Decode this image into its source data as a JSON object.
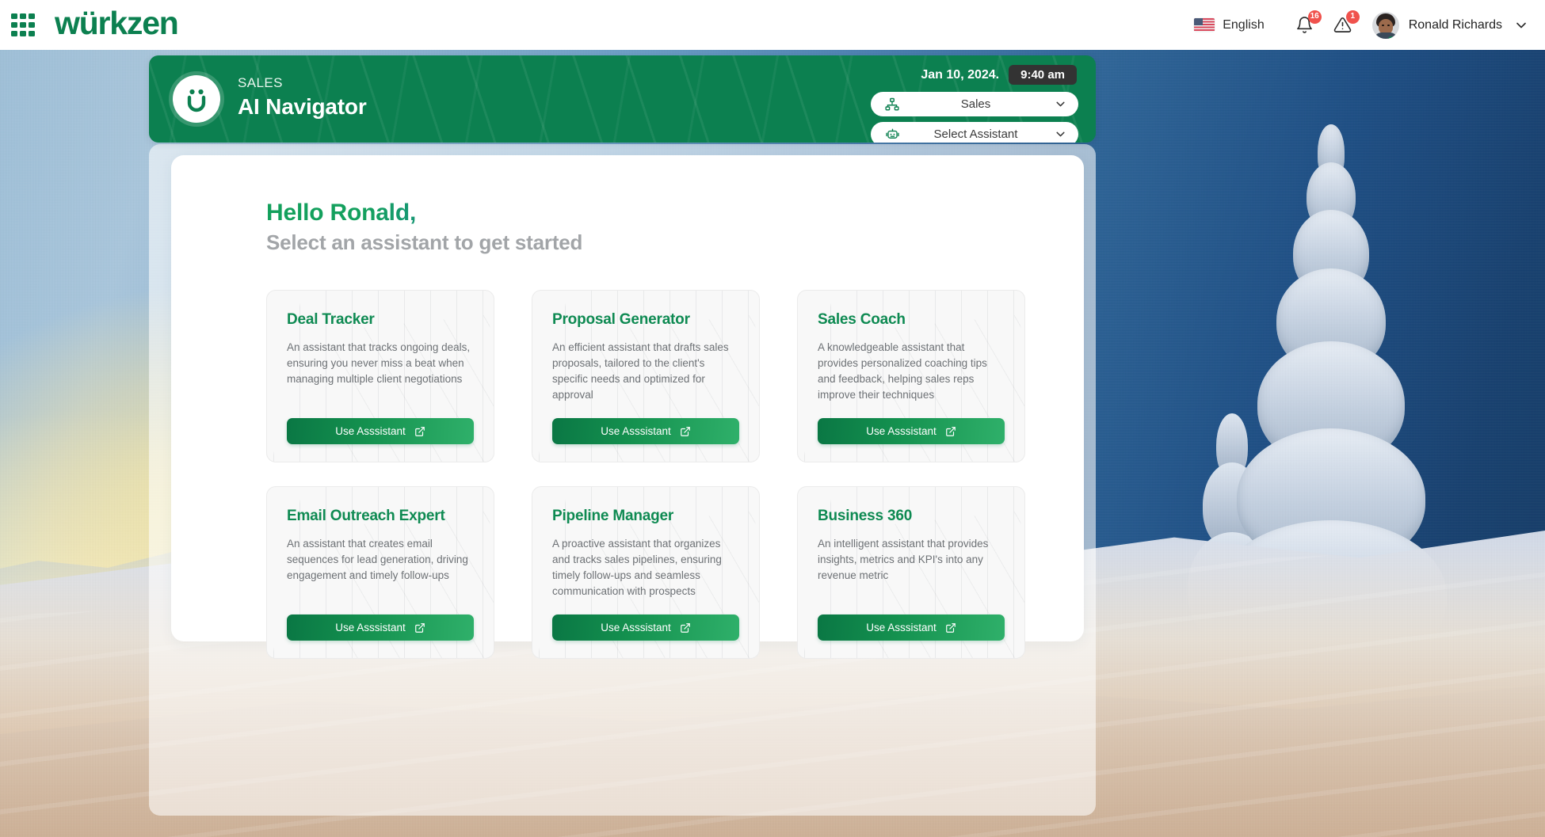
{
  "topbar": {
    "app_grid_icon": "apps-grid-icon",
    "brand": "würkzen",
    "language": {
      "label": "English",
      "flag_icon": "us-flag-icon"
    },
    "notifications": {
      "icon": "bell-icon",
      "badge": "16"
    },
    "alerts": {
      "icon": "warning-triangle-icon",
      "badge": "1"
    },
    "user": {
      "name": "Ronald Richards",
      "avatar_icon": "user-avatar",
      "chevron_icon": "chevron-down-icon"
    }
  },
  "banner": {
    "logo_icon": "wurkzen-smiley-logo",
    "kicker": "SALES",
    "title": "AI Navigator",
    "date": "Jan 10, 2024.",
    "time": "9:40 am",
    "department_select": {
      "icon": "org-chart-icon",
      "value": "Sales",
      "chevron_icon": "chevron-down-icon"
    },
    "assistant_select": {
      "icon": "robot-icon",
      "value": "Select Assistant",
      "chevron_icon": "chevron-down-icon"
    }
  },
  "main": {
    "greeting": "Hello Ronald,",
    "subheading": "Select an assistant to get started",
    "button_label": "Use Asssistant",
    "button_icon": "external-link-icon",
    "cards": [
      {
        "title": "Deal Tracker",
        "description": "An assistant that tracks ongoing deals, ensuring you never miss a beat when managing multiple client negotiations"
      },
      {
        "title": "Proposal Generator",
        "description": "An efficient assistant that drafts sales proposals, tailored to the client's specific needs and optimized for approval"
      },
      {
        "title": "Sales Coach",
        "description": "A knowledgeable assistant that provides personalized coaching tips and feedback, helping sales reps improve their techniques"
      },
      {
        "title": "Email Outreach Expert",
        "description": "An assistant that creates email sequences for lead generation, driving engagement and timely follow-ups"
      },
      {
        "title": "Pipeline Manager",
        "description": "A proactive assistant that organizes and tracks sales pipelines, ensuring timely follow-ups and seamless communication with prospects"
      },
      {
        "title": "Business 360",
        "description": "An intelligent assistant that provides insights, metrics and KPI's into any revenue metric"
      }
    ]
  },
  "colors": {
    "brand_green": "#0c8050",
    "card_title_green": "#0e8a52",
    "badge_red": "#f0524d",
    "time_pill_dark": "#333333"
  }
}
